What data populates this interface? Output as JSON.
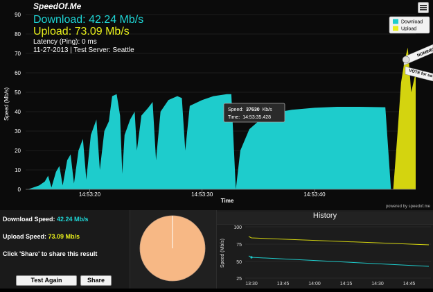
{
  "app": {
    "brand": "SpeedOf.Me"
  },
  "stats": {
    "download_label": "Download:",
    "download_value": "42.24 Mb/s",
    "upload_label": "Upload:",
    "upload_value": "73.09 Mb/s",
    "latency": "Latency (Ping): 0 ms",
    "date_server": "11-27-2013 | Test Server: Seattle"
  },
  "legend": {
    "download": "Download",
    "upload": "Upload"
  },
  "ribbons": {
    "nominee": "NOMINEE",
    "vote": "VOTE for us"
  },
  "tooltip": {
    "speed_label": "Speed:",
    "speed_value": "37630",
    "speed_unit": "Kb/s",
    "time_label": "Time:",
    "time_value": "14:53:35.428"
  },
  "powered": "powered by speedof.me",
  "chart_data": {
    "type": "area",
    "ylabel": "Speed (Mb/s)",
    "xlabel": "Time",
    "ylim": [
      0,
      90
    ],
    "yticks": [
      0,
      10,
      20,
      30,
      40,
      50,
      60,
      70,
      80,
      90
    ],
    "xticks": [
      {
        "label": "14:53:20",
        "t": 20
      },
      {
        "label": "14:53:30",
        "t": 30
      },
      {
        "label": "14:53:40",
        "t": 40
      }
    ],
    "xlim": [
      14.3,
      49
    ],
    "series": [
      {
        "name": "Download",
        "color": "#1ecccc",
        "points": [
          [
            14.5,
            0
          ],
          [
            15,
            1
          ],
          [
            15.5,
            2
          ],
          [
            16,
            4
          ],
          [
            16.3,
            7
          ],
          [
            16.6,
            1
          ],
          [
            17,
            9
          ],
          [
            17.3,
            12
          ],
          [
            17.6,
            2
          ],
          [
            18,
            15
          ],
          [
            18.3,
            18
          ],
          [
            18.6,
            3
          ],
          [
            19,
            20
          ],
          [
            19.4,
            26
          ],
          [
            19.7,
            5
          ],
          [
            20.1,
            28
          ],
          [
            20.6,
            36
          ],
          [
            20.9,
            10
          ],
          [
            21.3,
            30
          ],
          [
            21.7,
            35
          ],
          [
            22,
            48
          ],
          [
            22.4,
            49
          ],
          [
            22.7,
            38
          ],
          [
            22.9,
            8
          ],
          [
            23.1,
            28
          ],
          [
            23.6,
            36
          ],
          [
            24,
            40
          ],
          [
            24.2,
            20
          ],
          [
            24.6,
            38
          ],
          [
            25.2,
            42
          ],
          [
            25.6,
            45
          ],
          [
            25.9,
            15
          ],
          [
            26.3,
            40
          ],
          [
            27,
            46
          ],
          [
            27.8,
            48
          ],
          [
            28.2,
            47
          ],
          [
            28.5,
            20
          ],
          [
            28.9,
            43
          ],
          [
            30,
            46
          ],
          [
            31,
            48
          ],
          [
            32.2,
            49
          ],
          [
            32.6,
            49
          ],
          [
            33,
            0
          ],
          [
            33.4,
            20
          ],
          [
            34.2,
            31
          ],
          [
            35,
            35
          ],
          [
            35.5,
            37.6
          ],
          [
            36.5,
            39.5
          ],
          [
            38,
            41
          ],
          [
            40,
            42
          ],
          [
            42,
            42.5
          ],
          [
            44,
            42.5
          ],
          [
            46.3,
            42.3
          ],
          [
            46.8,
            0
          ]
        ]
      },
      {
        "name": "Upload",
        "color": "#d4d40f",
        "points": [
          [
            47,
            0
          ],
          [
            47.4,
            30
          ],
          [
            47.7,
            55
          ],
          [
            48,
            66
          ],
          [
            48.3,
            73
          ],
          [
            48.6,
            50
          ],
          [
            49,
            60
          ]
        ]
      }
    ]
  },
  "results": {
    "download_label": "Download Speed:",
    "download_value": "42.24 Mb/s",
    "upload_label": "Upload Speed:",
    "upload_value": "73.09 Mb/s",
    "share_hint": "Click 'Share' to share this result",
    "test_again": "Test Again",
    "share": "Share"
  },
  "history": {
    "title": "History",
    "ylabel": "Speed (Mb/s)",
    "yticks": [
      "100",
      "75",
      "50",
      "25"
    ],
    "xticks": [
      "13:30",
      "13:45",
      "14:00",
      "14:15",
      "14:30",
      "14:45"
    ],
    "series": [
      {
        "name": "Download",
        "color": "#1ecccc"
      },
      {
        "name": "Upload",
        "color": "#d4d40f"
      }
    ]
  },
  "pie_color": "#f7b885"
}
